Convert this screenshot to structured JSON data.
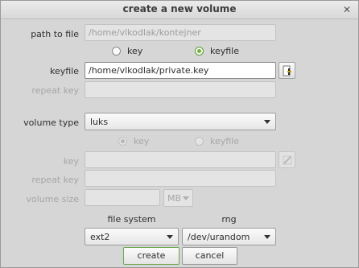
{
  "window": {
    "title": "create a new volume",
    "close_glyph": "✕"
  },
  "path_to_file": {
    "label": "path to file",
    "value": "/home/vlkodlak/kontejner"
  },
  "top_radio": {
    "key_label": "key",
    "keyfile_label": "keyfile",
    "selected": "keyfile"
  },
  "keyfile": {
    "label": "keyfile",
    "value": "/home/vlkodlak/private.key",
    "browse_icon": "file-browse-icon"
  },
  "repeat_key_top": {
    "label": "repeat key",
    "value": ""
  },
  "volume_type": {
    "label": "volume type",
    "value": "luks"
  },
  "sub_radio": {
    "key_label": "key",
    "keyfile_label": "keyfile",
    "selected": "key"
  },
  "key": {
    "label": "key",
    "value": "",
    "icon": "key-browse-icon"
  },
  "repeat_key": {
    "label": "repeat key",
    "value": ""
  },
  "volume_size": {
    "label": "volume size",
    "value": "",
    "unit": "MB"
  },
  "file_system": {
    "header": "file system",
    "value": "ext2"
  },
  "rng": {
    "header": "rng",
    "value": "/dev/urandom"
  },
  "buttons": {
    "create": "create",
    "cancel": "cancel"
  }
}
